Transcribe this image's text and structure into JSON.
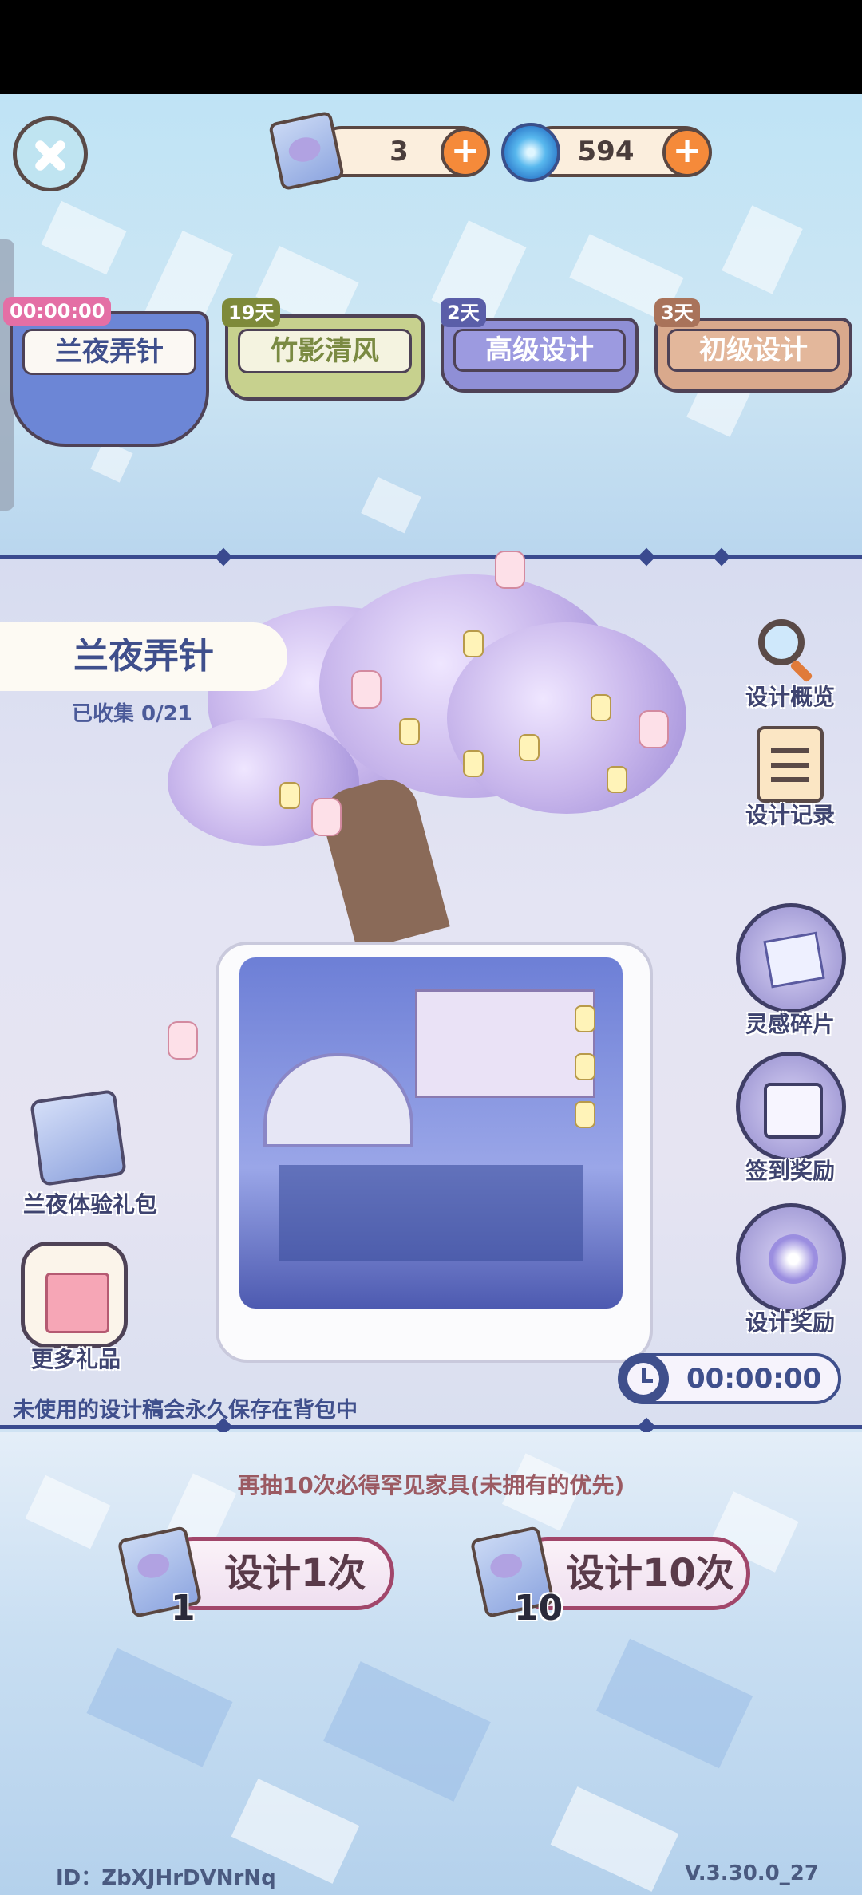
{
  "currency": {
    "scrolls": "3",
    "gems": "594",
    "plus_symbol": "+"
  },
  "tabs": [
    {
      "label": "兰夜弄针",
      "badge": "00:00:00",
      "color": "#6c86d6"
    },
    {
      "label": "竹影清风",
      "badge": "19天",
      "color": "#c7d18e"
    },
    {
      "label": "高级设计",
      "badge": "2天",
      "color": "#8f8fd6"
    },
    {
      "label": "初级设计",
      "badge": "3天",
      "color": "#d9a98c"
    }
  ],
  "pool": {
    "name": "兰夜弄针",
    "collected": "已收集 0/21"
  },
  "side_buttons": {
    "overview": "设计概览",
    "records": "设计记录",
    "inspiration": "灵感碎片",
    "checkin": "签到奖励",
    "design_reward": "设计奖励"
  },
  "left_buttons": {
    "trial_pack": "兰夜体验礼包",
    "more_gifts": "更多礼品"
  },
  "timer": "00:00:00",
  "notice": "未使用的设计稿会永久保存在背包中",
  "guarantee": "再抽10次必得罕见家具(未拥有的优先)",
  "draw": {
    "single_label": "设计1次",
    "single_count": "1",
    "ten_label": "设计10次",
    "ten_count": "10"
  },
  "footer": {
    "id": "ID：ZbXJHrDVNrNq",
    "version": "V.3.30.0_27"
  },
  "icons": {
    "close": "close-icon",
    "scroll": "scroll-icon",
    "gem": "swirl-gem-icon",
    "search": "magnifier-icon",
    "clipboard": "clipboard-icon",
    "clock": "clock-icon"
  }
}
